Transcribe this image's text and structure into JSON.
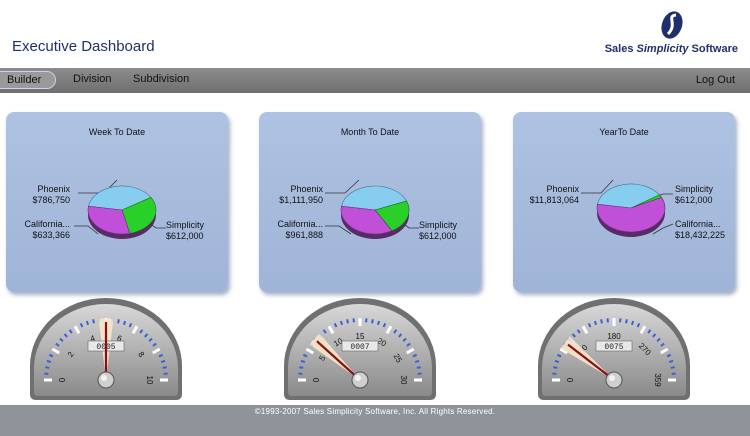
{
  "header": {
    "title": "Executive Dashboard",
    "brand_prefix": "Sales ",
    "brand_emph": "Simplicity",
    "brand_suffix": " Software"
  },
  "nav": {
    "items": [
      "Builder",
      "Division",
      "Subdivision"
    ],
    "active": "Builder",
    "logout": "Log Out"
  },
  "panels": [
    {
      "title": "Week To Date",
      "slices": [
        {
          "name": "Phoenix",
          "value": "$786,750",
          "color": "#87cdf0"
        },
        {
          "name": "Simplicity",
          "value": "$612,000",
          "color": "#2ad02a"
        },
        {
          "name": "California...",
          "value": "$633,366",
          "color": "#c050d8"
        }
      ]
    },
    {
      "title": "Month To Date",
      "slices": [
        {
          "name": "Phoenix",
          "value": "$1,111,950",
          "color": "#87cdf0"
        },
        {
          "name": "Simplicity",
          "value": "$612,000",
          "color": "#2ad02a"
        },
        {
          "name": "California...",
          "value": "$961,888",
          "color": "#c050d8"
        }
      ]
    },
    {
      "title": "YearTo Date",
      "slices": [
        {
          "name": "Phoenix",
          "value": "$11,813,064",
          "color": "#87cdf0"
        },
        {
          "name": "Simplicity",
          "value": "$612,000",
          "color": "#2ad02a"
        },
        {
          "name": "California...",
          "value": "$18,432,225",
          "color": "#c050d8"
        }
      ]
    }
  ],
  "gauges": [
    {
      "min": 0,
      "max": 10,
      "labels": [
        "0",
        "2",
        "4",
        "6",
        "8",
        "10"
      ],
      "value": 5,
      "odometer": "0005"
    },
    {
      "min": 0,
      "max": 30,
      "labels": [
        "0",
        "5",
        "10",
        "15",
        "20",
        "25",
        "30"
      ],
      "value": 7,
      "odometer": "0007"
    },
    {
      "min": 0,
      "max": 359,
      "labels": [
        "0",
        "90",
        "180",
        "270",
        "359"
      ],
      "value": 75,
      "odometer": "0075"
    }
  ],
  "footer": {
    "copyright": "©1993-2007 Sales Simplicity Software, Inc. All Rights Reserved."
  }
}
